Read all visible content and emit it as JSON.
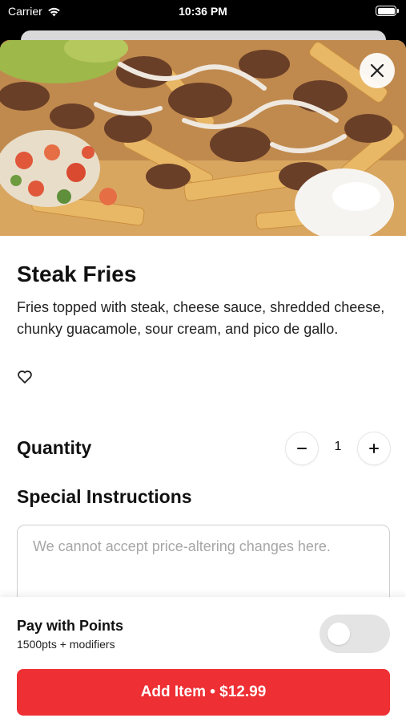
{
  "status_bar": {
    "carrier": "Carrier",
    "time": "10:36 PM",
    "icons": [
      "wifi-icon",
      "battery-icon"
    ]
  },
  "item": {
    "title": "Steak Fries",
    "description": "Fries topped with steak, cheese sauce, shredded cheese, chunky guacamole, sour cream, and pico de gallo.",
    "favorite_icon": "heart-outline-icon",
    "close_icon": "close-icon"
  },
  "quantity": {
    "label": "Quantity",
    "value": "1",
    "minus_icon": "minus-icon",
    "plus_icon": "plus-icon"
  },
  "instructions": {
    "label": "Special Instructions",
    "placeholder": "We cannot accept price-altering changes here.",
    "value": ""
  },
  "points": {
    "label": "Pay with Points",
    "sublabel": "1500pts + modifiers",
    "enabled": false
  },
  "cta": {
    "label": "Add Item • $12.99"
  },
  "colors": {
    "accent": "#ee2f34",
    "toggle_off": "#e4e4e4",
    "text": "#111111"
  }
}
